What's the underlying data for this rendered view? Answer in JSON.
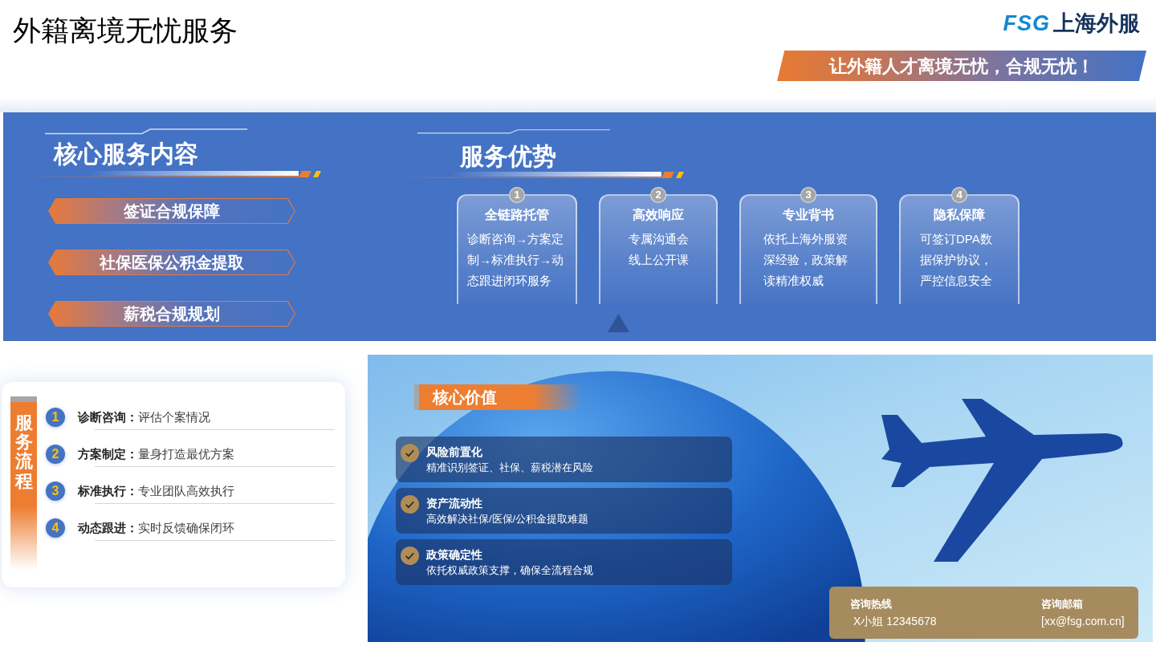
{
  "header": {
    "title": "外籍离境无忧服务",
    "logo": {
      "mark": "FSG",
      "name": "上海外服"
    },
    "slogan": "让外籍人才离境无忧，合规无忧！"
  },
  "core_services": {
    "heading": "核心服务内容",
    "items": [
      "签证合规保障",
      "社保医保公积金提取",
      "薪税合规规划"
    ]
  },
  "advantages": {
    "heading": "服务优势",
    "cards": [
      {
        "number": "1",
        "title": "全链路托管",
        "lines": [
          "诊断咨询→方案定制→标准执行→动态跟进闭环服务"
        ]
      },
      {
        "number": "2",
        "title": "高效响应",
        "lines": [
          "专属沟通会",
          "线上公开课"
        ]
      },
      {
        "number": "3",
        "title": "专业背书",
        "lines": [
          "依托上海外服资深经验，政策解读精准权威"
        ]
      },
      {
        "number": "4",
        "title": "隐私保障",
        "lines": [
          "可签订DPA数据保护协议，严控信息安全"
        ]
      }
    ]
  },
  "process": {
    "label": "服务流程",
    "steps": [
      {
        "number": "1",
        "title": "诊断咨询：",
        "text": "评估个案情况"
      },
      {
        "number": "2",
        "title": "方案制定：",
        "text": "量身打造最优方案"
      },
      {
        "number": "3",
        "title": "标准执行：",
        "text": "专业团队高效执行"
      },
      {
        "number": "4",
        "title": "动态跟进：",
        "text": "实时反馈确保闭环"
      }
    ]
  },
  "core_value": {
    "heading": "核心价值",
    "items": [
      {
        "title": "风险前置化",
        "text": "精准识别签证、社保、薪税潜在风险"
      },
      {
        "title": "资产流动性",
        "text": "高效解决社保/医保/公积金提取难题"
      },
      {
        "title": "政策确定性",
        "text": "依托权威政策支撑，确保全流程合规"
      }
    ]
  },
  "contact": {
    "hotline_label": "咨询热线",
    "hotline": "X小姐 12345678",
    "email_label": "咨询邮箱",
    "email": "[xx@fsg.com.cn]"
  }
}
